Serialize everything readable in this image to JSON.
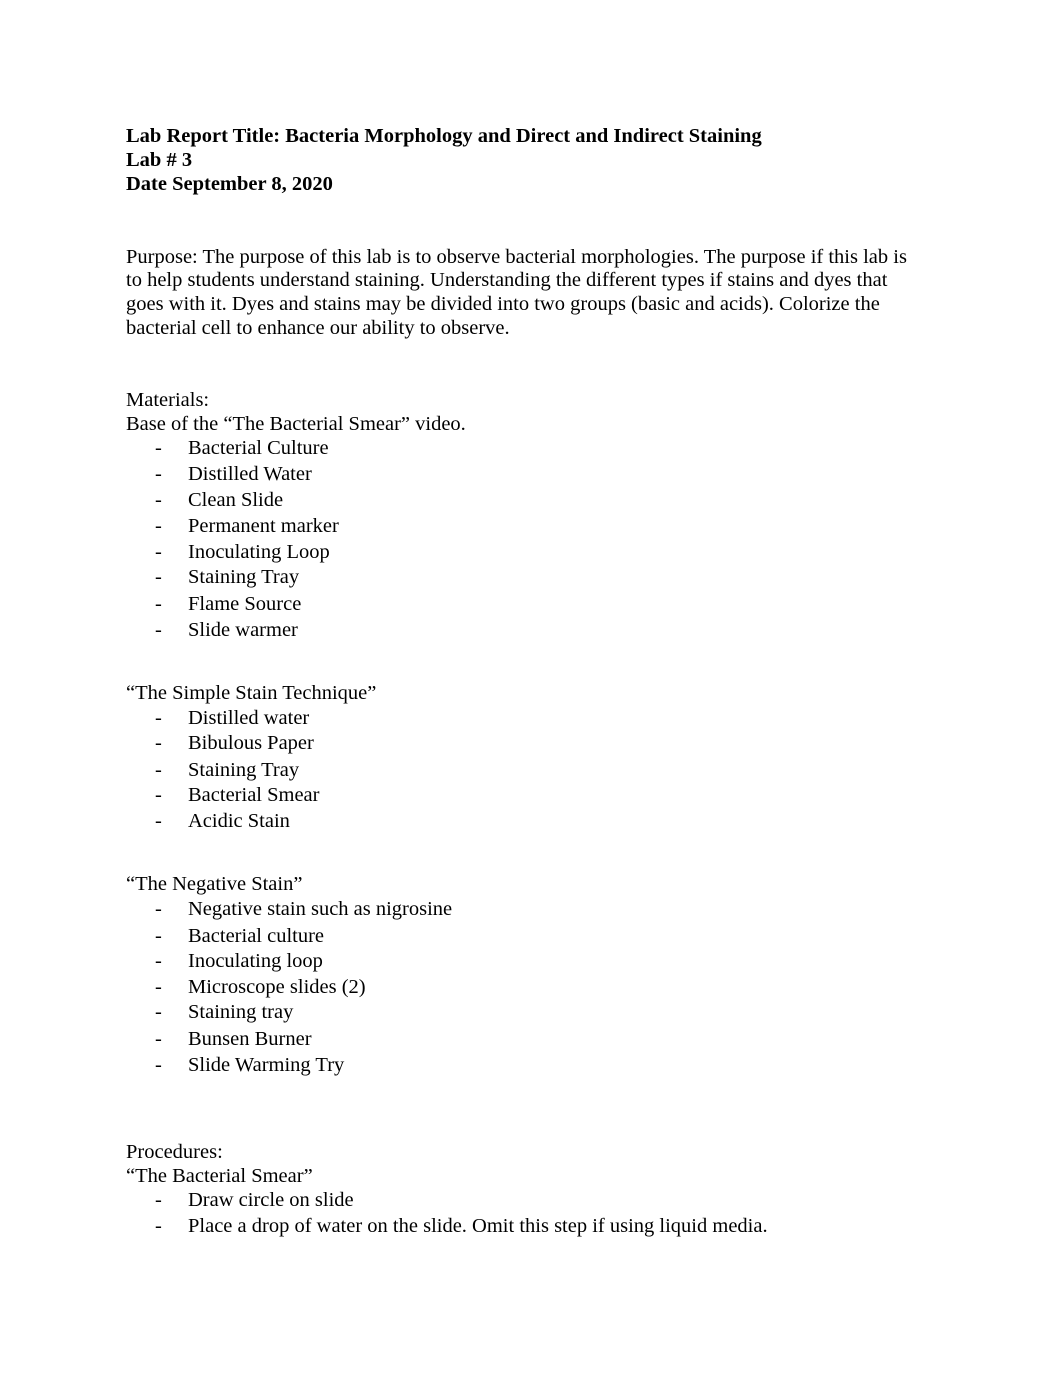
{
  "header": {
    "title": "Lab Report Title: Bacteria Morphology and Direct and Indirect Staining",
    "lab_number": "Lab # 3",
    "date": "Date September 8, 2020"
  },
  "purpose": {
    "lines": [
      "Purpose: The purpose of this lab is to observe bacterial morphologies. The purpose if this lab is",
      "to help students understand staining. Understanding the different types if stains and dyes that",
      "goes with it. Dyes and stains may be divided into two groups (basic and acids). Colorize the",
      "bacterial cell to enhance our ability to observe."
    ]
  },
  "materials": {
    "heading": "Materials:",
    "intro": "Base of the “The Bacterial Smear” video.",
    "bullet_char": "-",
    "bacterial_smear_items": [
      "Bacterial Culture",
      "Distilled Water",
      "Clean Slide",
      "Permanent marker",
      "Inoculating Loop",
      "Staining Tray",
      "Flame Source",
      "Slide warmer"
    ],
    "simple_stain": {
      "heading": "“The Simple Stain Technique”",
      "items": [
        "Distilled water",
        "Bibulous Paper",
        "Staining Tray",
        "Bacterial Smear",
        "Acidic Stain"
      ]
    },
    "negative_stain": {
      "heading": "“The Negative Stain”",
      "items": [
        "Negative stain such as nigrosine",
        "Bacterial culture",
        "Inoculating loop",
        "Microscope slides (2)",
        "Staining tray",
        "Bunsen Burner",
        "Slide Warming Try"
      ]
    }
  },
  "procedures": {
    "heading": "Procedures:",
    "bacterial_smear": {
      "heading": "“The Bacterial Smear”",
      "items": [
        "Draw circle on slide",
        "Place a drop of water on the slide. Omit this step if using liquid media."
      ]
    }
  }
}
